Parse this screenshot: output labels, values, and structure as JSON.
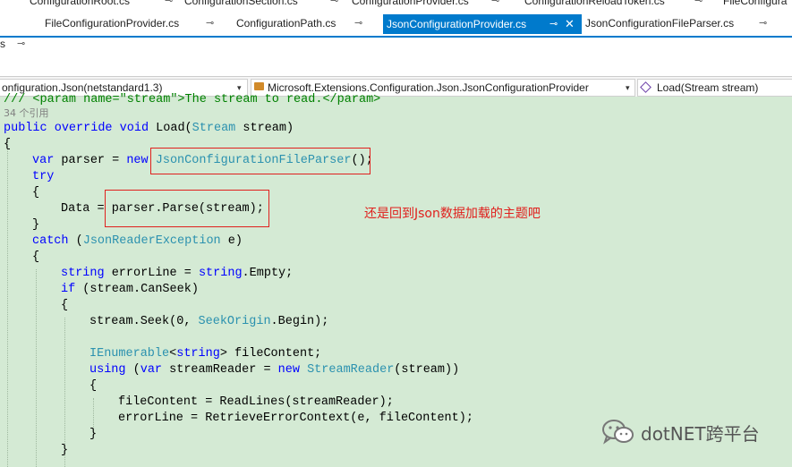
{
  "tabs_row1": [
    "ConfigurationRoot.cs",
    "ConfigurationSection.cs",
    "ConfigurationProvider.cs",
    "ConfigurationReloadToken.cs",
    "FileConfigura"
  ],
  "tabs_row2": [
    "FileConfigurationProvider.cs",
    "ConfigurationPath.cs",
    "JsonConfigurationProvider.cs",
    "JsonConfigurationFileParser.cs"
  ],
  "tabs_row3": [
    "s"
  ],
  "pin_glyph": "⊸",
  "close_glyph": "✕",
  "navbar": {
    "project": "onfiguration.Json(netstandard1.3)",
    "class": "Microsoft.Extensions.Configuration.Json.JsonConfigurationProvider",
    "member": "Load(Stream stream)",
    "dropdown_glyph": "▾"
  },
  "code": {
    "l0": "/// <param name=\"stream\">The stream to read.</param>",
    "refs": "34 个引用",
    "l1_public": "public",
    "l1_override": "override",
    "l1_void": "void",
    "l1_load": "Load(",
    "l1_stream_type": "Stream",
    "l1_rest": " stream)",
    "brace_open": "{",
    "brace_close": "}",
    "l3_var": "var",
    "l3_parser": " parser = ",
    "l3_new": "new",
    "l3_type": "JsonConfigurationFileParser",
    "l3_end": "();",
    "try": "try",
    "l6_data": "Data = ",
    "l6_parse": "parser.Parse(stream);",
    "catch": "catch",
    "catch_open": " (",
    "catch_type": "JsonReaderException",
    "catch_rest": " e)",
    "l10_string": "string",
    "l10_mid": " errorLine = ",
    "l10_string2": "string",
    "l10_end": ".Empty;",
    "l11_if": "if",
    "l11_rest": " (stream.CanSeek)",
    "l13_a": "stream.Seek(0, ",
    "l13_type": "SeekOrigin",
    "l13_end": ".Begin);",
    "l15_type": "IEnumerable",
    "l15_lt": "<",
    "l15_string": "string",
    "l15_gt": ">",
    "l15_end": " fileContent;",
    "l16_using": "using",
    "l16_open": " (",
    "l16_var": "var",
    "l16_mid": " streamReader = ",
    "l16_new": "new",
    "l16_type": "StreamReader",
    "l16_end": "(stream))",
    "l18": "fileContent = ReadLines(streamReader);",
    "l19": "errorLine = RetrieveErrorContext(e, fileContent);"
  },
  "annotation": "还是回到Json数据加载的主题吧",
  "watermark": {
    "text": "dotNET跨平台",
    "icon": "wechat-icon"
  },
  "colors": {
    "editor_bg": "#d4ead4",
    "keyword": "#0000ff",
    "type": "#2b91af",
    "comment": "#008000",
    "accent": "#007acc",
    "annotation": "#e0201d"
  }
}
